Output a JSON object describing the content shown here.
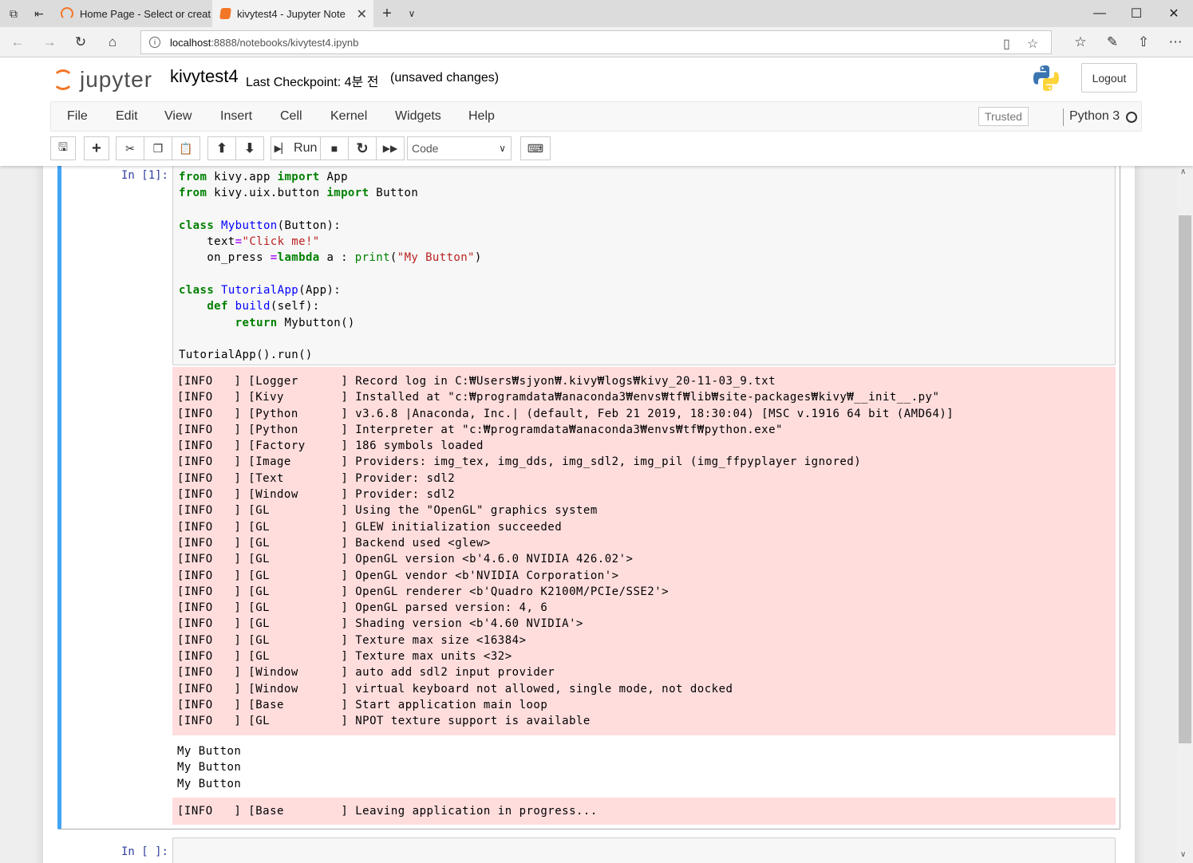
{
  "browser": {
    "tabs": [
      {
        "title": "Home Page - Select or creat"
      },
      {
        "title": "kivytest4 - Jupyter Note"
      }
    ],
    "url_host": "localhost",
    "url_path": ":8888/notebooks/kivytest4.ipynb"
  },
  "header": {
    "logo_text": "jupyter",
    "notebook_name": "kivytest4",
    "checkpoint": "Last Checkpoint: 4분 전",
    "unsaved": "(unsaved changes)",
    "logout_label": "Logout"
  },
  "menu": {
    "items": [
      "File",
      "Edit",
      "View",
      "Insert",
      "Cell",
      "Kernel",
      "Widgets",
      "Help"
    ],
    "trusted": "Trusted",
    "kernel": "Python 3"
  },
  "toolbar": {
    "run_label": "Run",
    "cell_type": "Code"
  },
  "cells": [
    {
      "prompt": "In [1]:",
      "stderr_lines": [
        "[INFO   ] [Logger      ] Record log in C:₩Users₩sjyon₩.kivy₩logs₩kivy_20-11-03_9.txt",
        "[INFO   ] [Kivy        ] Installed at \"c:₩programdata₩anaconda3₩envs₩tf₩lib₩site-packages₩kivy₩__init__.py\"",
        "[INFO   ] [Python      ] v3.6.8 |Anaconda, Inc.| (default, Feb 21 2019, 18:30:04) [MSC v.1916 64 bit (AMD64)]",
        "[INFO   ] [Python      ] Interpreter at \"c:₩programdata₩anaconda3₩envs₩tf₩python.exe\"",
        "[INFO   ] [Factory     ] 186 symbols loaded",
        "[INFO   ] [Image       ] Providers: img_tex, img_dds, img_sdl2, img_pil (img_ffpyplayer ignored)",
        "[INFO   ] [Text        ] Provider: sdl2",
        "[INFO   ] [Window      ] Provider: sdl2",
        "[INFO   ] [GL          ] Using the \"OpenGL\" graphics system",
        "[INFO   ] [GL          ] GLEW initialization succeeded",
        "[INFO   ] [GL          ] Backend used <glew>",
        "[INFO   ] [GL          ] OpenGL version <b'4.6.0 NVIDIA 426.02'>",
        "[INFO   ] [GL          ] OpenGL vendor <b'NVIDIA Corporation'>",
        "[INFO   ] [GL          ] OpenGL renderer <b'Quadro K2100M/PCIe/SSE2'>",
        "[INFO   ] [GL          ] OpenGL parsed version: 4, 6",
        "[INFO   ] [GL          ] Shading version <b'4.60 NVIDIA'>",
        "[INFO   ] [GL          ] Texture max size <16384>",
        "[INFO   ] [GL          ] Texture max units <32>",
        "[INFO   ] [Window      ] auto add sdl2 input provider",
        "[INFO   ] [Window      ] virtual keyboard not allowed, single mode, not docked",
        "[INFO   ] [Base        ] Start application main loop",
        "[INFO   ] [GL          ] NPOT texture support is available"
      ],
      "stdout_lines": [
        "My Button",
        "My Button",
        "My Button"
      ],
      "stderr2_lines": [
        "[INFO   ] [Base        ] Leaving application in progress..."
      ]
    },
    {
      "prompt": "In [ ]:"
    }
  ],
  "code": {
    "from": "from",
    "import": "import",
    "class": "class",
    "def": "def",
    "return": "return",
    "lambda": "lambda",
    "print": "print",
    "kivy_app": " kivy.app ",
    "kivy_uix_button": " kivy.uix.button ",
    "app": " App",
    "button": " Button",
    "mybutton_name": "Mybutton",
    "tutorialapp_name": "TutorialApp",
    "build_name": "build",
    "paren_button": "(Button):",
    "paren_app": "(App):",
    "paren_self": "(self):",
    "text_assign": "    text",
    "eq": "=",
    "click_me": "\"Click me!\"",
    "on_press": "    on_press ",
    "lambda_a": " a : ",
    "my_button_str": "\"My Button\"",
    "open_paren": "(",
    "close_paren": ")",
    "indent4": "    ",
    "indent8": "        ",
    "mybutton_call": " Mybutton()",
    "run_call": "TutorialApp().run()"
  }
}
